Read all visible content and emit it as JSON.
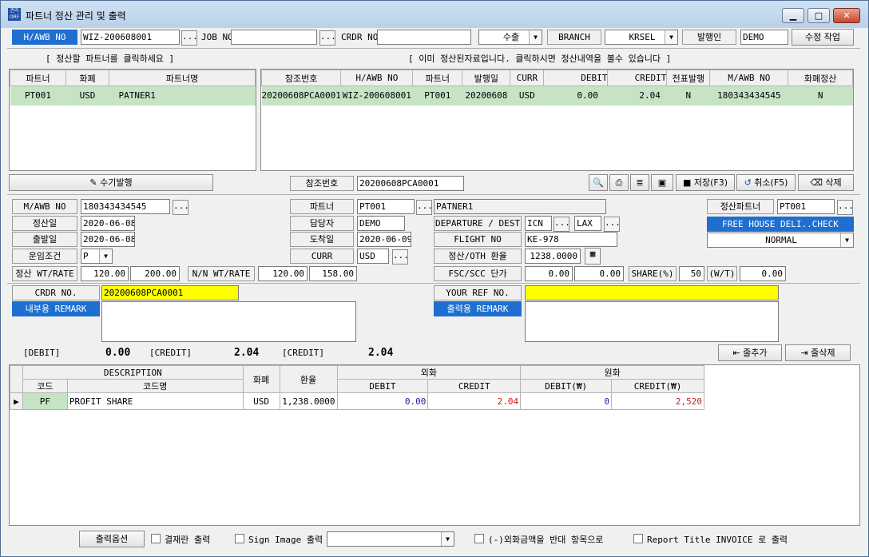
{
  "window": {
    "title": "파트너 정산 관리 및 출력",
    "icon": "app-icon",
    "min": "▁",
    "max": "□",
    "close": "✕"
  },
  "top": {
    "hawb_label": "H/AWB NO",
    "hawb_value": "WIZ-200608001",
    "job_label": "JOB NO",
    "job_value": "",
    "crdr_label": "CRDR NO",
    "crdr_value": "",
    "direction": "수출",
    "branch_label": "BRANCH",
    "branch_value": "KRSEL",
    "issuer_label": "발행인",
    "issuer_value": "DEMO",
    "edit_button": "수정 작업"
  },
  "hints": {
    "left": "[ 정산할 파트너를 클릭하세요 ]",
    "right": "[ 이미 정산된자료입니다. 클릭하시면 정산내역을 볼수 있습니다 ]"
  },
  "partner_grid": {
    "headers": [
      "파트너",
      "화폐",
      "파트너명"
    ],
    "rows": [
      [
        "PT001",
        "USD",
        "PATNER1"
      ]
    ]
  },
  "settled_grid": {
    "headers": [
      "참조번호",
      "H/AWB NO",
      "파트너",
      "발행일",
      "CURR",
      "DEBIT",
      "CREDIT",
      "전표발행",
      "M/AWB NO",
      "화폐정산"
    ],
    "rows": [
      [
        "20200608PCA0001",
        "WIZ-200608001",
        "PT001",
        "20200608",
        "USD",
        "0.00",
        "2.04",
        "N",
        "180343434545",
        "N"
      ]
    ]
  },
  "toolbar": {
    "manual_issue": "수기발행",
    "ref_label": "참조번호",
    "ref_value": "20200608PCA0001",
    "save": "저장(F3)",
    "cancel": "취소(F5)",
    "delete": "삭제"
  },
  "form": {
    "mawb_label": "M/AWB NO",
    "mawb_value": "180343434545",
    "settle_date_label": "정산일",
    "settle_date": "2020-06-08",
    "depart_date_label": "출발일",
    "depart_date": "2020-06-08",
    "freight_label": "운임조건",
    "freight_value": "P",
    "weight_label": "정산 WT/RATE",
    "weight": "120.00",
    "rate": "200.00",
    "nn_label": "N/N WT/RATE",
    "nn_weight": "120.00",
    "nn_rate": "158.00",
    "partner_label": "파트너",
    "partner_code": "PT001",
    "partner_name": "PATNER1",
    "manager_label": "담당자",
    "manager": "DEMO",
    "arrival_label": "도착일",
    "arrival": "2020-06-09",
    "curr_label": "CURR",
    "curr": "USD",
    "dep_dest_label": "DEPARTURE / DEST",
    "departure": "ICN",
    "dest": "LAX",
    "flight_label": "FLIGHT NO",
    "flight": "KE-978",
    "exch_label": "정산/OTH 환율",
    "exch": "1238.0000",
    "fsc_label": "FSC/SCC 단가",
    "fsc": "0.00",
    "scc": "0.00",
    "share_label": "SHARE(%)",
    "share": "50",
    "wt_label": "(W/T)",
    "wt": "0.00",
    "settle_partner_label": "정산파트너",
    "settle_partner": "PT001",
    "free_house": "FREE HOUSE DELI..CHECK",
    "normal": "NORMAL",
    "crdr_label": "CRDR NO.",
    "crdr_value": "20200608PCA0001",
    "internal_remark_label": "내부용 REMARK",
    "your_ref_label": "YOUR REF NO.",
    "print_remark_label": "출력용 REMARK"
  },
  "totals": {
    "debit_label": "[DEBIT]",
    "debit": "0.00",
    "credit_label": "[CREDIT]",
    "credit": "2.04",
    "credit2_label": "[CREDIT]",
    "credit2": "2.04",
    "add_row": "줄추가",
    "del_row": "줄삭제"
  },
  "detail_grid": {
    "desc_header": "DESCRIPTION",
    "code": "코드",
    "code_name": "코드명",
    "currency": "화폐",
    "rate": "환율",
    "foreign": "외화",
    "won": "원화",
    "debit": "DEBIT",
    "credit": "CREDIT",
    "debit_w": "DEBIT(₩)",
    "credit_w": "CREDIT(₩)",
    "rows": [
      {
        "code": "PF",
        "name": "PROFIT SHARE",
        "cur": "USD",
        "rate": "1,238.0000",
        "debit": "0.00",
        "credit": "2.04",
        "debit_w": "0",
        "credit_w": "2,520"
      }
    ]
  },
  "footer": {
    "options": "출력옵션",
    "opt1": "결재란 출력",
    "opt2": "Sign Image 출력",
    "opt3": "(-)외화금액을 반대 항목으로",
    "opt4": "Report Title INVOICE 로 출력"
  },
  "colors": {
    "blue": "#1e6fd0",
    "yellow": "#ffff00",
    "row": "#c6e3c6",
    "debit": "#1a1aa6",
    "credit": "#d01818"
  }
}
